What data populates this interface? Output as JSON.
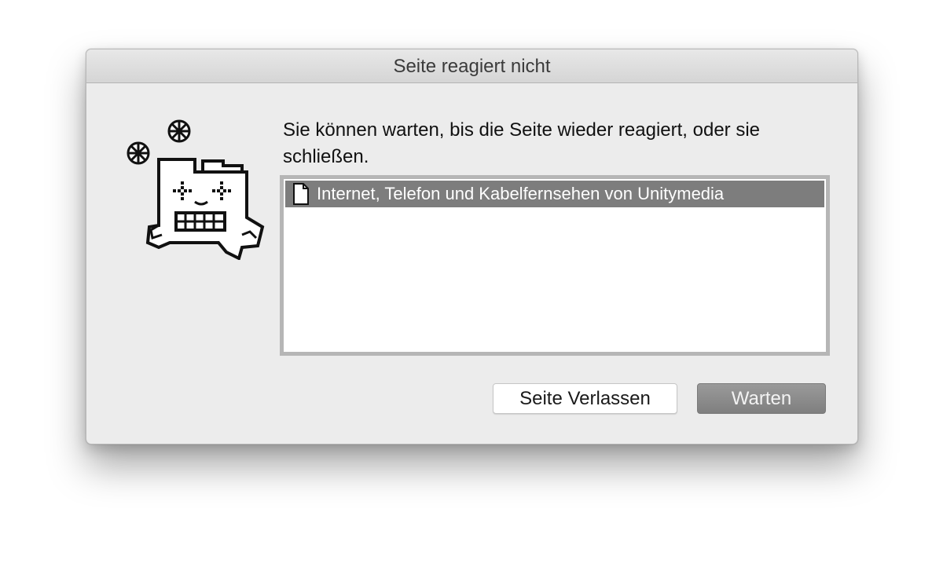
{
  "dialog": {
    "title": "Seite reagiert nicht",
    "message": "Sie können warten, bis die Seite wieder reagiert, oder sie schließen.",
    "mascot_icon": "frozen-browser-mascot-icon",
    "snowflake_icon": "snowflake-icon"
  },
  "pages_list": {
    "items": [
      {
        "icon": "document-icon",
        "label": "Internet, Telefon und Kabelfernsehen von Unitymedia",
        "selected": true
      }
    ]
  },
  "buttons": {
    "leave_label": "Seite Verlassen",
    "wait_label": "Warten"
  },
  "colors": {
    "selection": "#7d7d7d",
    "default_button": "#8c8c8c",
    "window_background": "#ececec"
  }
}
